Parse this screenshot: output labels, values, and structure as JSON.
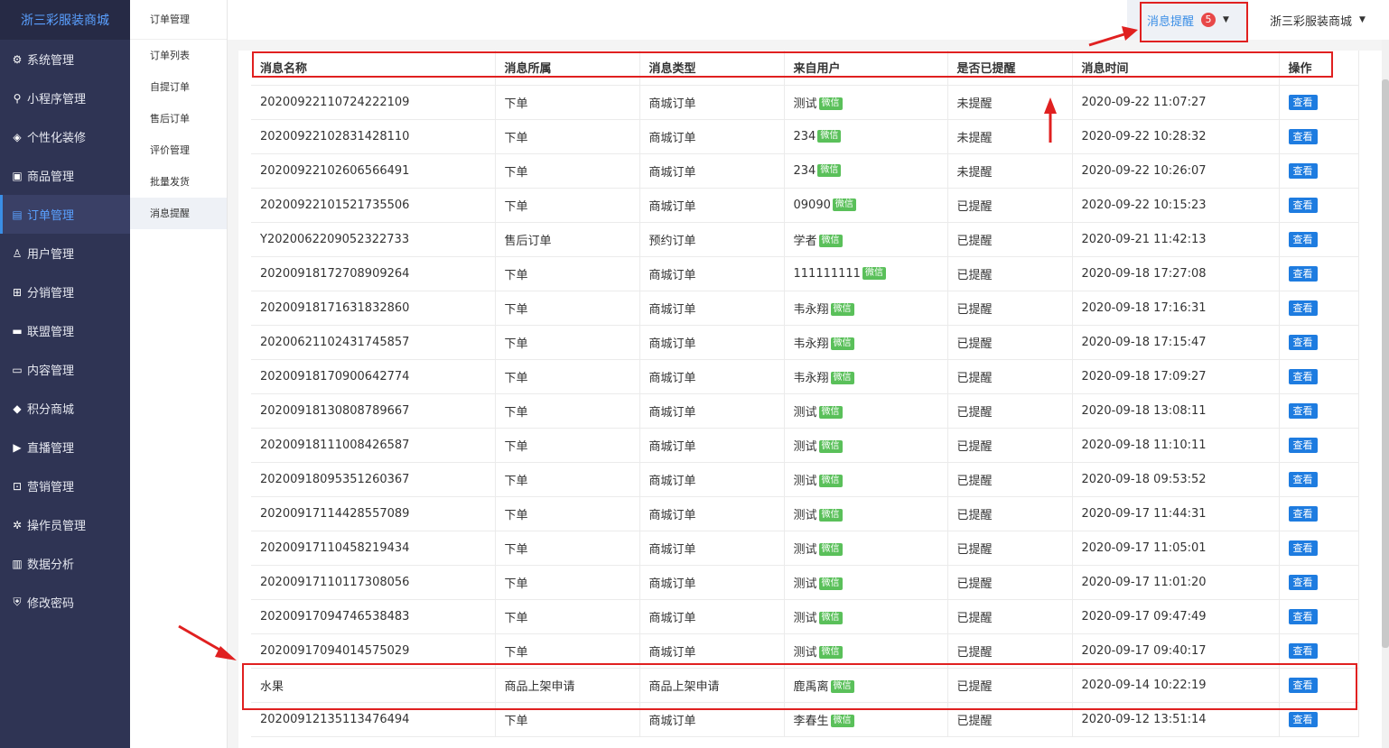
{
  "app_title": "浙三彩服装商城",
  "sidebar": {
    "items": [
      {
        "label": "系统管理",
        "icon": "gear-icon",
        "glyph": "⚙"
      },
      {
        "label": "小程序管理",
        "icon": "link-icon",
        "glyph": "⚲"
      },
      {
        "label": "个性化装修",
        "icon": "layers-icon",
        "glyph": "◈"
      },
      {
        "label": "商品管理",
        "icon": "package-icon",
        "glyph": "▣"
      },
      {
        "label": "订单管理",
        "icon": "order-icon",
        "glyph": "▤",
        "active": true
      },
      {
        "label": "用户管理",
        "icon": "user-icon",
        "glyph": "♙"
      },
      {
        "label": "分销管理",
        "icon": "network-icon",
        "glyph": "⊞"
      },
      {
        "label": "联盟管理",
        "icon": "shop-icon",
        "glyph": "▬"
      },
      {
        "label": "内容管理",
        "icon": "content-icon",
        "glyph": "▭"
      },
      {
        "label": "积分商城",
        "icon": "cube-icon",
        "glyph": "◆"
      },
      {
        "label": "直播管理",
        "icon": "play-icon",
        "glyph": "▶"
      },
      {
        "label": "营销管理",
        "icon": "marketing-icon",
        "glyph": "⊡"
      },
      {
        "label": "操作员管理",
        "icon": "operator-gear-icon",
        "glyph": "✲"
      },
      {
        "label": "数据分析",
        "icon": "bar-chart-icon",
        "glyph": "▥"
      },
      {
        "label": "修改密码",
        "icon": "shield-icon",
        "glyph": "⛨"
      }
    ]
  },
  "submenu": {
    "title": "订单管理",
    "items": [
      {
        "label": "订单列表"
      },
      {
        "label": "自提订单"
      },
      {
        "label": "售后订单"
      },
      {
        "label": "评价管理"
      },
      {
        "label": "批量发货"
      },
      {
        "label": "消息提醒",
        "active": true
      }
    ]
  },
  "topbar": {
    "msg_label": "消息提醒",
    "msg_count": "5",
    "shop_name": "浙三彩服装商城"
  },
  "table": {
    "headers": [
      "消息名称",
      "消息所属",
      "消息类型",
      "来自用户",
      "是否已提醒",
      "消息时间",
      "操作"
    ],
    "wx_tag": "微信",
    "action_label": "查看",
    "rows": [
      {
        "name": "20200922110724222109",
        "belong": "下单",
        "type": "商城订单",
        "user": "测试",
        "reminded": "未提醒",
        "time": "2020-09-22 11:07:27"
      },
      {
        "name": "20200922102831428110",
        "belong": "下单",
        "type": "商城订单",
        "user": "234",
        "reminded": "未提醒",
        "time": "2020-09-22 10:28:32"
      },
      {
        "name": "20200922102606566491",
        "belong": "下单",
        "type": "商城订单",
        "user": "234",
        "reminded": "未提醒",
        "time": "2020-09-22 10:26:07"
      },
      {
        "name": "20200922101521735506",
        "belong": "下单",
        "type": "商城订单",
        "user": "09090",
        "reminded": "已提醒",
        "time": "2020-09-22 10:15:23"
      },
      {
        "name": "Y2020062209052322733",
        "belong": "售后订单",
        "type": "预约订单",
        "user": "学者",
        "reminded": "已提醒",
        "time": "2020-09-21 11:42:13"
      },
      {
        "name": "20200918172708909264",
        "belong": "下单",
        "type": "商城订单",
        "user": "111111111",
        "reminded": "已提醒",
        "time": "2020-09-18 17:27:08"
      },
      {
        "name": "20200918171631832860",
        "belong": "下单",
        "type": "商城订单",
        "user": "韦永翔",
        "reminded": "已提醒",
        "time": "2020-09-18 17:16:31"
      },
      {
        "name": "20200621102431745857",
        "belong": "下单",
        "type": "商城订单",
        "user": "韦永翔",
        "reminded": "已提醒",
        "time": "2020-09-18 17:15:47"
      },
      {
        "name": "20200918170900642774",
        "belong": "下单",
        "type": "商城订单",
        "user": "韦永翔",
        "reminded": "已提醒",
        "time": "2020-09-18 17:09:27"
      },
      {
        "name": "20200918130808789667",
        "belong": "下单",
        "type": "商城订单",
        "user": "测试",
        "reminded": "已提醒",
        "time": "2020-09-18 13:08:11"
      },
      {
        "name": "20200918111008426587",
        "belong": "下单",
        "type": "商城订单",
        "user": "测试",
        "reminded": "已提醒",
        "time": "2020-09-18 11:10:11"
      },
      {
        "name": "20200918095351260367",
        "belong": "下单",
        "type": "商城订单",
        "user": "测试",
        "reminded": "已提醒",
        "time": "2020-09-18 09:53:52"
      },
      {
        "name": "20200917114428557089",
        "belong": "下单",
        "type": "商城订单",
        "user": "测试",
        "reminded": "已提醒",
        "time": "2020-09-17 11:44:31"
      },
      {
        "name": "20200917110458219434",
        "belong": "下单",
        "type": "商城订单",
        "user": "测试",
        "reminded": "已提醒",
        "time": "2020-09-17 11:05:01"
      },
      {
        "name": "20200917110117308056",
        "belong": "下单",
        "type": "商城订单",
        "user": "测试",
        "reminded": "已提醒",
        "time": "2020-09-17 11:01:20"
      },
      {
        "name": "20200917094746538483",
        "belong": "下单",
        "type": "商城订单",
        "user": "测试",
        "reminded": "已提醒",
        "time": "2020-09-17 09:47:49"
      },
      {
        "name": "20200917094014575029",
        "belong": "下单",
        "type": "商城订单",
        "user": "测试",
        "reminded": "已提醒",
        "time": "2020-09-17 09:40:17"
      },
      {
        "name": "水果",
        "belong": "商品上架申请",
        "type": "商品上架申请",
        "user": "鹿禹离",
        "reminded": "已提醒",
        "time": "2020-09-14 10:22:19"
      },
      {
        "name": "20200912135113476494",
        "belong": "下单",
        "type": "商城订单",
        "user": "李春生",
        "reminded": "已提醒",
        "time": "2020-09-12 13:51:14"
      }
    ]
  },
  "colors": {
    "sidebar_bg": "#2f3454",
    "accent": "#3a8ee6",
    "badge": "#e84848",
    "wx_tag": "#5ac05a",
    "action_button": "#1e7ce0",
    "annotation": "#e02020"
  }
}
